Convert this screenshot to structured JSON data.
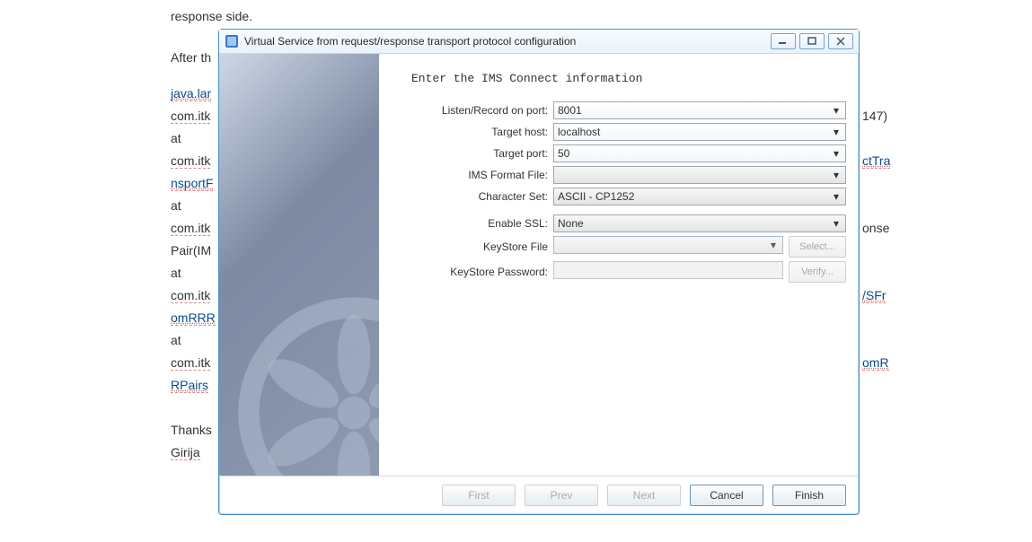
{
  "background": {
    "line1": "response   side.",
    "line2": "After th",
    "stack": [
      "java.lar",
      "com.itk",
      "at",
      "com.itk",
      "nsportF",
      "at",
      "com.itk",
      "Pair(IM",
      "at",
      "com.itk",
      "omRRR",
      "at",
      "com.itk",
      "RPairs"
    ],
    "right_fragments": [
      "147)",
      "ctTra",
      "onse",
      "/SFr",
      "omR"
    ],
    "sig1": "Thanks",
    "sig2": "Girija"
  },
  "dialog": {
    "title": "Virtual Service from request/response transport protocol configuration",
    "heading": "Enter the IMS Connect information",
    "fields": {
      "listen_port": {
        "label": "Listen/Record on port:",
        "value": "8001"
      },
      "target_host": {
        "label": "Target host:",
        "value": "localhost"
      },
      "target_port": {
        "label": "Target port:",
        "value": "50"
      },
      "ims_format": {
        "label": "IMS Format File:",
        "value": ""
      },
      "charset": {
        "label": "Character Set:",
        "value": "ASCII - CP1252"
      },
      "enable_ssl": {
        "label": "Enable SSL:",
        "value": "None"
      },
      "keystore_file": {
        "label": "KeyStore File",
        "value": "",
        "button": "Select..."
      },
      "keystore_pw": {
        "label": "KeyStore Password:",
        "value": "",
        "button": "Verify..."
      }
    },
    "footer": {
      "first": "First",
      "prev": "Prev",
      "next": "Next",
      "cancel": "Cancel",
      "finish": "Finish"
    }
  }
}
